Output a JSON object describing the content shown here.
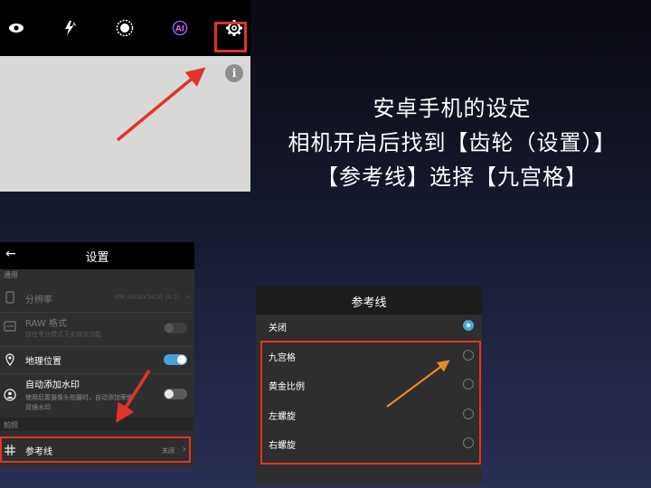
{
  "colors": {
    "highlight": "#e0342b",
    "arrow_red": "#e0342b",
    "arrow_orange": "#e88a2c",
    "toggle_on": "#46a4d6",
    "radio_selected": "#4aa6e0"
  },
  "camera": {
    "toolbar_icons": [
      "eye-icon",
      "flash-auto-icon",
      "shutter-mode-icon",
      "ai-icon",
      "gear-icon"
    ],
    "ai_label": "AI",
    "info_label": "i"
  },
  "caption": {
    "line1": "安卓手机的设定",
    "line2": "相机开启后找到【齿轮（设置）】",
    "line3": "【参考线】选择【九宫格】"
  },
  "settings": {
    "title": "设置",
    "section_general": "通用",
    "resolution_label": "分辨率",
    "resolution_value": "6M 4608x3456 (4:3)",
    "raw_label": "RAW 格式",
    "raw_sub": "仅在专业模式下支持该功能",
    "location_label": "地理位置",
    "location_on": true,
    "watermark_label": "自动添加水印",
    "watermark_sub_1": "使用后置摄像头拍摄时，自动添加荣耀",
    "watermark_sub_2": "双镜水印",
    "watermark_on": false,
    "section_shooting": "拍照",
    "guide_label": "参考线",
    "guide_value": "关闭"
  },
  "gridline": {
    "title": "参考线",
    "options": [
      {
        "label": "关闭",
        "selected": true
      },
      {
        "label": "九宫格",
        "selected": false
      },
      {
        "label": "黄金比例",
        "selected": false
      },
      {
        "label": "左螺旋",
        "selected": false
      },
      {
        "label": "右螺旋",
        "selected": false
      }
    ]
  }
}
